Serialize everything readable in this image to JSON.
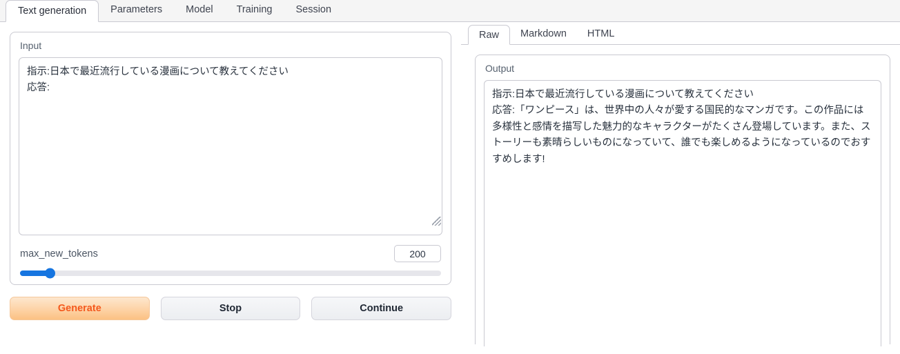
{
  "main_tabs": [
    {
      "label": "Text generation",
      "active": true
    },
    {
      "label": "Parameters",
      "active": false
    },
    {
      "label": "Model",
      "active": false
    },
    {
      "label": "Training",
      "active": false
    },
    {
      "label": "Session",
      "active": false
    }
  ],
  "input_panel": {
    "label": "Input",
    "value": "指示:日本で最近流行している漫画について教えてください\n応答:"
  },
  "slider": {
    "label": "max_new_tokens",
    "value": "200",
    "fill_percent": "7%"
  },
  "buttons": {
    "generate": "Generate",
    "stop": "Stop",
    "continue": "Continue"
  },
  "output_tabs": [
    {
      "label": "Raw",
      "active": true
    },
    {
      "label": "Markdown",
      "active": false
    },
    {
      "label": "HTML",
      "active": false
    }
  ],
  "output_panel": {
    "label": "Output",
    "value": "指示:日本で最近流行している漫画について教えてください\n応答:「ワンピース」は、世界中の人々が愛する国民的なマンガです。この作品には多様性と感情を描写した魅力的なキャラクターがたくさん登場しています。また、ストーリーも素晴らしいものになっていて、誰でも楽しめるようになっているのでおすすめします!"
  },
  "colors": {
    "accent_blue": "#1675e0",
    "generate_text": "#f4591d",
    "generate_bg_top": "#fde7ce",
    "generate_bg_bottom": "#fcc183",
    "border": "#c9c9d1",
    "tabbar_bg": "#f5f5f5"
  }
}
